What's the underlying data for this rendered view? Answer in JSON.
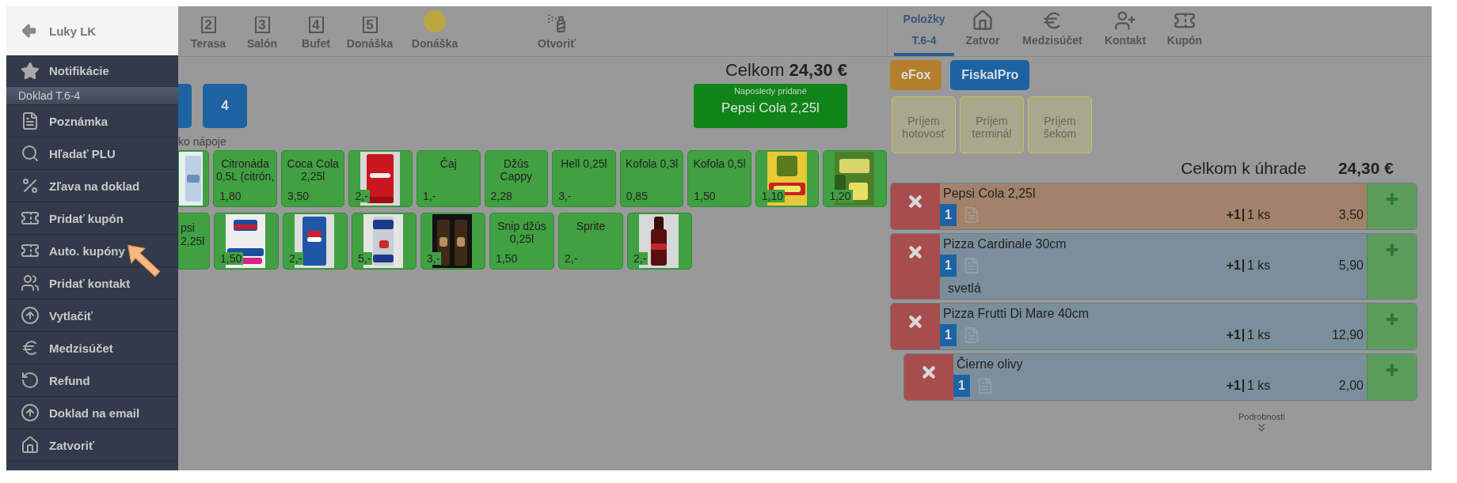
{
  "drawer": {
    "user": "Luky LK",
    "notifications": "Notifikácie",
    "section": "Doklad T.6-4",
    "items": [
      {
        "label": "Poznámka"
      },
      {
        "label": "Hľadať PLU"
      },
      {
        "label": "Zľava na doklad"
      },
      {
        "label": "Pridať kupón"
      },
      {
        "label": "Auto. kupóny"
      },
      {
        "label": "Pridať kontakt"
      },
      {
        "label": "Vytlačiť"
      },
      {
        "label": "Medzisúčet"
      },
      {
        "label": "Refund"
      },
      {
        "label": "Doklad na email"
      },
      {
        "label": "Zatvoriť"
      }
    ]
  },
  "toolbar": {
    "tables": [
      {
        "number": "2",
        "label": "Terasa"
      },
      {
        "number": "3",
        "label": "Salón"
      },
      {
        "number": "4",
        "label": "Bufet"
      },
      {
        "number": "5",
        "label": "Donáška"
      }
    ],
    "add_delivery": "Donáška",
    "open": "Otvoriť",
    "tabs": [
      {
        "label": "Položky",
        "sublabel": "T.6-4",
        "selected": true
      },
      {
        "label": "Zatvor",
        "selected": false
      },
      {
        "label": "Medzisúčet",
        "selected": false
      },
      {
        "label": "Kontakt",
        "selected": false
      },
      {
        "label": "Kupón",
        "selected": false
      }
    ]
  },
  "sections": [
    {
      "kind": "partial"
    },
    {
      "kind": "full",
      "label": "4"
    }
  ],
  "total": {
    "label": "Celkom",
    "amount": "24,30 €"
  },
  "last_added": {
    "caption": "Naposledy pridané",
    "name": "Pepsi Cola 2,25l"
  },
  "category": "ko nápoje",
  "products": [
    [
      {
        "kind": "partial_image"
      },
      {
        "kind": "text",
        "name": "Citronáda 0,5L (citrón,",
        "price": "1,80"
      },
      {
        "kind": "text",
        "name": "Coca Cola 2,25l",
        "price": "3,50"
      },
      {
        "price": "2,-"
      },
      {
        "kind": "text",
        "name": "Čaj",
        "price": "1,-"
      },
      {
        "kind": "text",
        "name": "Džús Cappy",
        "price": "2,28"
      },
      {
        "kind": "text",
        "name": "Hell 0,25l",
        "price": "3,-"
      },
      {
        "kind": "text",
        "name": "Kofola 0,3l",
        "price": "0,85"
      },
      {
        "kind": "text",
        "name": "Kofola 0,5l",
        "price": "1,50"
      },
      {
        "price": "1,10"
      },
      {
        "price": "1,20"
      }
    ],
    [
      {
        "kind": "partial_text",
        "name": "psi 2,25l"
      },
      {
        "price": "1,50"
      },
      {
        "price": "2,-"
      },
      {
        "price": "5,-"
      },
      {
        "price": "3,-"
      },
      {
        "kind": "text",
        "name": "Snip džús 0,25l",
        "price": "1,50"
      },
      {
        "kind": "text",
        "name": "Sprite",
        "price": "2,-"
      },
      {
        "price": "2,-"
      }
    ]
  ],
  "fiscal_buttons": [
    {
      "label": "eFox",
      "color": "#b37f2d"
    },
    {
      "label": "FiskalPro",
      "color": "#1c63a3"
    }
  ],
  "payments": [
    {
      "label": "Príjem hotovosť"
    },
    {
      "label": "Príjem terminál"
    },
    {
      "label": "Príjem šekom"
    }
  ],
  "due": {
    "label": "Celkom k úhrade",
    "amount": "24,30 €"
  },
  "order": [
    {
      "name": "Pepsi Cola 2,25l",
      "qty": "1",
      "increment": "+1",
      "count": "1 ks",
      "price": "3,50",
      "highlighted": true
    },
    {
      "name": "Pizza Cardinale 30cm",
      "qty": "1",
      "increment": "+1",
      "count": "1 ks",
      "price": "5,90",
      "highlighted": false,
      "note": "svetlá"
    },
    {
      "name": "Pizza Frutti Di Mare 40cm",
      "qty": "1",
      "increment": "+1",
      "count": "1 ks",
      "price": "12,90",
      "highlighted": false,
      "children": [
        {
          "name": "Čierne olivy",
          "qty": "1",
          "increment": "+1",
          "count": "1 ks",
          "price": "2,00",
          "highlighted": false
        }
      ]
    }
  ],
  "details": "Podrobnosti"
}
